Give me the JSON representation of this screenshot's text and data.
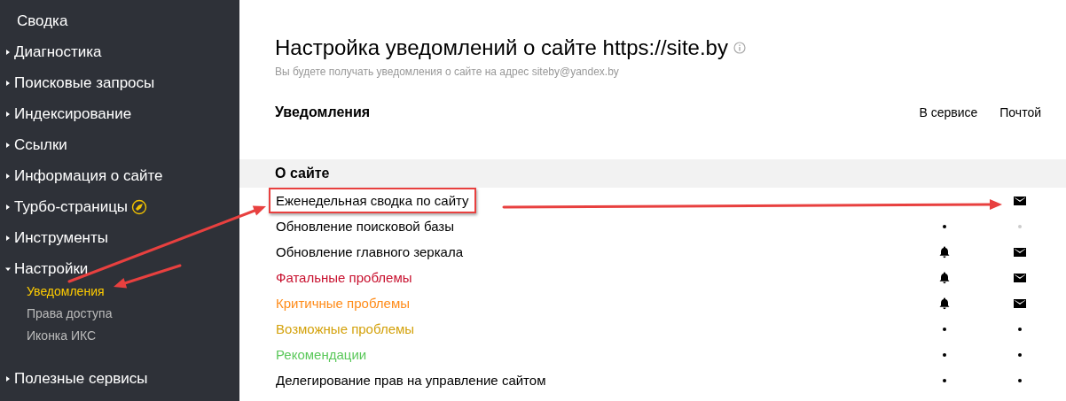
{
  "sidebar": {
    "items": [
      {
        "label": "Сводка",
        "kind": "plain"
      },
      {
        "label": "Диагностика",
        "kind": "group",
        "expanded": false
      },
      {
        "label": "Поисковые запросы",
        "kind": "group",
        "expanded": false
      },
      {
        "label": "Индексирование",
        "kind": "group",
        "expanded": false
      },
      {
        "label": "Ссылки",
        "kind": "group",
        "expanded": false
      },
      {
        "label": "Информация о сайте",
        "kind": "group",
        "expanded": false
      },
      {
        "label": "Турбо-страницы",
        "kind": "turbo",
        "expanded": false
      },
      {
        "label": "Инструменты",
        "kind": "group",
        "expanded": false
      },
      {
        "label": "Настройки",
        "kind": "group",
        "expanded": true,
        "children": [
          {
            "label": "Уведомления",
            "selected": true
          },
          {
            "label": "Права доступа",
            "selected": false
          },
          {
            "label": "Иконка ИКС",
            "selected": false
          }
        ]
      },
      {
        "label": "Полезные сервисы",
        "kind": "group",
        "expanded": false
      }
    ]
  },
  "page": {
    "title": "Настройка уведомлений о сайте https://site.by",
    "subtitle": "Вы будете получать уведомления о сайте на адрес siteby@yandex.by"
  },
  "table": {
    "heading": "Уведомления",
    "columns": [
      "В сервисе",
      "Почтой"
    ],
    "section": "О сайте",
    "rows": [
      {
        "label": "Еженедельная сводка по сайту",
        "color": "#000000",
        "annotated": true,
        "service_shown": false,
        "service_on": false,
        "mail_available": true,
        "mail_on": true
      },
      {
        "label": "Обновление поисковой базы",
        "color": "#000000",
        "annotated": false,
        "service_shown": true,
        "service_on": false,
        "mail_available": false,
        "mail_on": false
      },
      {
        "label": "Обновление главного зеркала",
        "color": "#000000",
        "annotated": false,
        "service_shown": true,
        "service_on": true,
        "mail_available": true,
        "mail_on": true
      },
      {
        "label": "Фатальные проблемы",
        "color": "#c8102e",
        "annotated": false,
        "service_shown": true,
        "service_on": true,
        "mail_available": true,
        "mail_on": true
      },
      {
        "label": "Критичные проблемы",
        "color": "#ff8c1a",
        "annotated": false,
        "service_shown": true,
        "service_on": true,
        "mail_available": true,
        "mail_on": true
      },
      {
        "label": "Возможные проблемы",
        "color": "#d4a20c",
        "annotated": false,
        "service_shown": true,
        "service_on": false,
        "mail_available": true,
        "mail_on": false
      },
      {
        "label": "Рекомендации",
        "color": "#5ac85a",
        "annotated": false,
        "service_shown": true,
        "service_on": false,
        "mail_available": true,
        "mail_on": false
      },
      {
        "label": "Делегирование прав на управление сайтом",
        "color": "#000000",
        "annotated": false,
        "service_shown": true,
        "service_on": false,
        "mail_available": true,
        "mail_on": false
      }
    ]
  }
}
